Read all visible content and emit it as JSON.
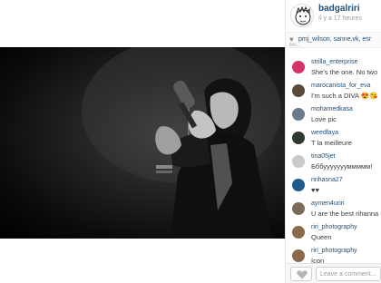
{
  "post": {
    "username": "badgalriri",
    "time": "Il y a 17 heures",
    "likes_users": "pmj_wilson, sanne.vk, esr",
    "likes_more": "this..."
  },
  "comments": [
    {
      "user": "strilla_enterprise",
      "text": "She's the one. No two",
      "avatar_color": "#d6336c"
    },
    {
      "user": "marocanista_for_eva",
      "text": "I'm such a DIVA 😍😘",
      "avatar_color": "#5a4a3a"
    },
    {
      "user": "mohamedkasa",
      "text": "Love pic",
      "avatar_color": "#6b7b8c"
    },
    {
      "user": "weedfaya",
      "text": "T la meilleure",
      "avatar_color": "#2f3a2f"
    },
    {
      "user": "tina05jet",
      "text": "Бббуууууууммммм!",
      "avatar_color": "#c9c9c9"
    },
    {
      "user": "ririhasna27",
      "text": "♥♥",
      "avatar_color": "#1e5a8a"
    },
    {
      "user": "aymen4uriri",
      "text": "U are the best rihanna I",
      "avatar_color": "#7a6a5a"
    },
    {
      "user": "riri_photography",
      "text": "Queen",
      "avatar_color": "#8a6a4a"
    },
    {
      "user": "riri_photography",
      "text": "Icon",
      "avatar_color": "#8a6a4a"
    }
  ],
  "footer": {
    "comment_placeholder": "Leave a comment..."
  },
  "icons": {
    "like": "heart-icon",
    "likes_indicator": "heart-icon"
  }
}
